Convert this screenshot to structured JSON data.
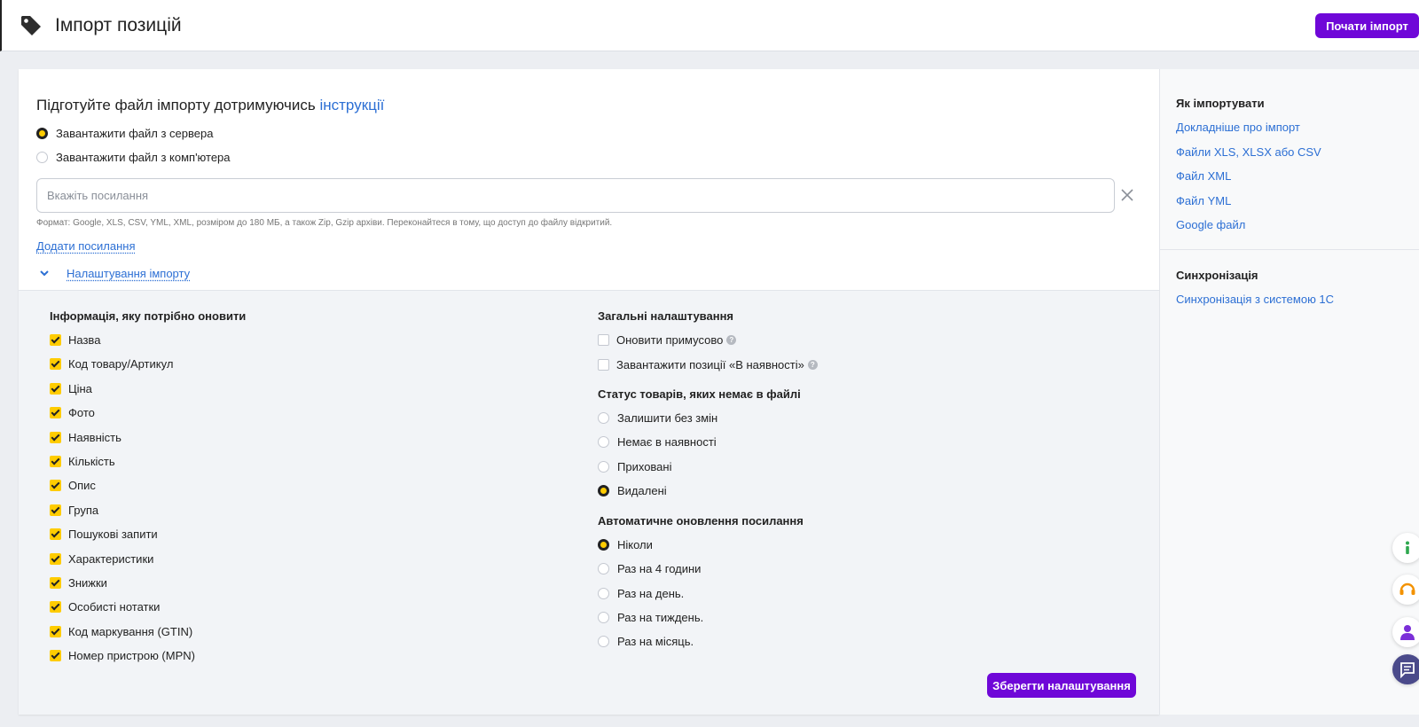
{
  "header": {
    "title": "Імпорт позицій",
    "start_button": "Почати імпорт"
  },
  "import": {
    "heading_prefix": "Підготуйте файл імпорту дотримуючись ",
    "heading_link": "інструкції",
    "source_options": [
      {
        "label": "Завантажити файл з сервера",
        "selected": true
      },
      {
        "label": "Завантажити файл з комп'ютера",
        "selected": false
      }
    ],
    "url_placeholder": "Вкажіть посилання",
    "url_value": "",
    "format_hint": "Формат: Google, XLS, CSV, YML, XML, розміром до 180 МБ, а також Zip, Gzip архіви. Переконайтеся в тому, що доступ до файлу відкритий.",
    "add_link": "Додати посилання",
    "settings_toggle": "Налаштування імпорту"
  },
  "update_info": {
    "title": "Інформація, яку потрібно оновити",
    "items": [
      {
        "label": "Назва",
        "checked": true
      },
      {
        "label": "Код товару/Артикул",
        "checked": true
      },
      {
        "label": "Ціна",
        "checked": true
      },
      {
        "label": "Фото",
        "checked": true
      },
      {
        "label": "Наявність",
        "checked": true
      },
      {
        "label": "Кількість",
        "checked": true
      },
      {
        "label": "Опис",
        "checked": true
      },
      {
        "label": "Група",
        "checked": true
      },
      {
        "label": "Пошукові запити",
        "checked": true
      },
      {
        "label": "Характеристики",
        "checked": true
      },
      {
        "label": "Знижки",
        "checked": true
      },
      {
        "label": "Особисті нотатки",
        "checked": true
      },
      {
        "label": "Код маркування (GTIN)",
        "checked": true
      },
      {
        "label": "Номер пристрою (MPN)",
        "checked": true
      }
    ]
  },
  "general": {
    "title": "Загальні налаштування",
    "items": [
      {
        "label": "Оновити примусово",
        "checked": false,
        "help": "?"
      },
      {
        "label": "Завантажити позиції «В наявності»",
        "checked": false,
        "help": "?"
      }
    ]
  },
  "missing_status": {
    "title": "Статус товарів, яких немає в файлі",
    "options": [
      {
        "label": "Залишити без змін",
        "selected": false
      },
      {
        "label": "Немає в наявності",
        "selected": false
      },
      {
        "label": "Приховані",
        "selected": false
      },
      {
        "label": "Видалені",
        "selected": true
      }
    ]
  },
  "auto_update": {
    "title": "Автоматичне оновлення посилання",
    "options": [
      {
        "label": "Ніколи",
        "selected": true
      },
      {
        "label": "Раз на 4 години",
        "selected": false
      },
      {
        "label": "Раз на день.",
        "selected": false
      },
      {
        "label": "Раз на тиждень.",
        "selected": false
      },
      {
        "label": "Раз на місяць.",
        "selected": false
      }
    ]
  },
  "save_button": "Зберегти налаштування",
  "sidebar": {
    "how_title": "Як імпортувати",
    "how_links": [
      "Докладніше про імпорт",
      "Файли XLS, XLSX або CSV",
      "Файл XML",
      "Файл YML",
      "Google файл"
    ],
    "sync_title": "Синхронізація",
    "sync_links": [
      "Синхронізація з системою 1С"
    ]
  },
  "floating": [
    {
      "icon": "info-icon",
      "color": "#2fa84f"
    },
    {
      "icon": "headset-icon",
      "color": "#f39200"
    },
    {
      "icon": "person-icon",
      "color": "#7b2fd8"
    },
    {
      "icon": "chat-icon",
      "color": "#4a4a8a"
    }
  ],
  "colors": {
    "accent": "#6f07d8",
    "link": "#2c6fd4",
    "check": "#ffcc00"
  }
}
